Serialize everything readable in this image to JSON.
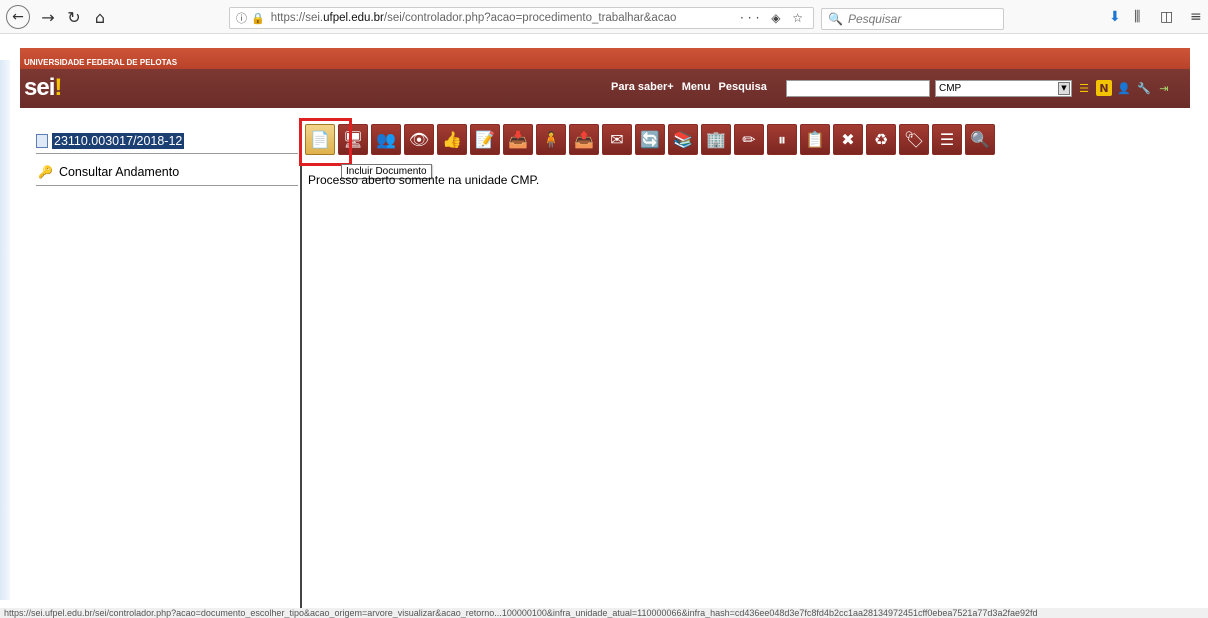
{
  "browser": {
    "url_prefix": "https://sei.",
    "url_domain": "ufpel.edu.br",
    "url_rest": "/sei/controlador.php?acao=procedimento_trabalhar&acao",
    "url_actions": "··· ◈ ☆",
    "search_placeholder": "Pesquisar"
  },
  "header": {
    "university": "UNIVERSIDADE FEDERAL DE PELOTAS",
    "logo": "sei",
    "logo_mark": "!",
    "links": [
      "Para saber+",
      "Menu",
      "Pesquisa"
    ],
    "search_value": "",
    "unit_selected": "CMP"
  },
  "tree": {
    "process_number": "23110.003017/2018-12",
    "consult_label": "Consultar Andamento"
  },
  "toolbar": {
    "buttons": [
      {
        "name": "incluir-documento-button",
        "glyph": "📄"
      },
      {
        "name": "iniciar-processo-relacionado-button",
        "glyph": "🖥"
      },
      {
        "name": "enviar-processo-button",
        "glyph": "👥"
      },
      {
        "name": "acompanhamento-button",
        "glyph": "👁"
      },
      {
        "name": "atribuir-processo-button",
        "glyph": "👍"
      },
      {
        "name": "anotacoes-button",
        "glyph": "📝"
      },
      {
        "name": "gerar-pdf-button",
        "glyph": "📥"
      },
      {
        "name": "ciencia-button",
        "glyph": "🧍"
      },
      {
        "name": "sobrestar-button",
        "glyph": "📤"
      },
      {
        "name": "enviar-email-button",
        "glyph": "✉"
      },
      {
        "name": "duplicar-processo-button",
        "glyph": "🔄"
      },
      {
        "name": "relacionamentos-button",
        "glyph": "📚"
      },
      {
        "name": "gerar-zip-button",
        "glyph": "🏢"
      },
      {
        "name": "anotar-button",
        "glyph": "✏"
      },
      {
        "name": "bloco-button",
        "glyph": "⏸"
      },
      {
        "name": "editar-processo-button",
        "glyph": "📋"
      },
      {
        "name": "excluir-button",
        "glyph": "✖"
      },
      {
        "name": "reciclar-button",
        "glyph": "♻"
      },
      {
        "name": "marcador-button",
        "glyph": "🏷"
      },
      {
        "name": "lista-button",
        "glyph": "☰"
      },
      {
        "name": "pesquisar-button",
        "glyph": "🔍"
      }
    ],
    "tooltip": "Incluir Documento"
  },
  "message": "Processo aberto somente na unidade CMP.",
  "status_url": "https://sei.ufpel.edu.br/sei/controlador.php?acao=documento_escolher_tipo&acao_origem=arvore_visualizar&acao_retorno...100000100&infra_unidade_atual=110000066&infra_hash=cd436ee048d3e7fc8fd4b2cc1aa28134972451cff0ebea7521a77d3a2fae92fd"
}
